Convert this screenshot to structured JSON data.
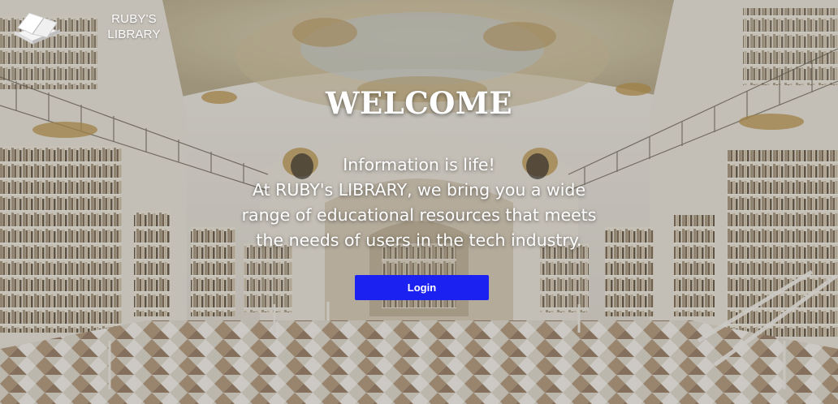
{
  "header": {
    "logo_icon": "books-icon",
    "brand_name": "RUBY'S\nLIBRARY"
  },
  "hero": {
    "title": "WELCOME",
    "tagline": [
      "Information is life!",
      "At RUBY's LIBRARY, we bring you a wide",
      "range of educational resources that meets",
      "the needs of users in the tech industry."
    ],
    "login_label": "Login"
  },
  "colors": {
    "button": "#1a21f0",
    "text": "#ffffff"
  }
}
